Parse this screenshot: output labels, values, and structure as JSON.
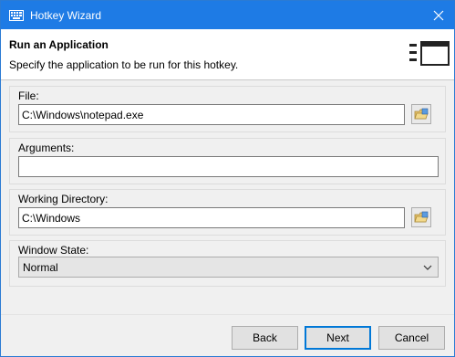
{
  "window": {
    "title": "Hotkey Wizard"
  },
  "header": {
    "title": "Run an Application",
    "subtitle": "Specify the application to be run for this hotkey."
  },
  "fields": {
    "file": {
      "label": "File:",
      "value": "C:\\Windows\\notepad.exe"
    },
    "arguments": {
      "label": "Arguments:",
      "value": ""
    },
    "working_directory": {
      "label": "Working Directory:",
      "value": "C:\\Windows"
    },
    "window_state": {
      "label": "Window State:",
      "selected": "Normal"
    }
  },
  "footer": {
    "back_label": "Back",
    "next_label": "Next",
    "cancel_label": "Cancel"
  },
  "icons": {
    "app": "keyboard-icon",
    "close": "close-icon",
    "wizard": "window-list-icon",
    "browse": "folder-browse-icon",
    "dropdown": "chevron-down-icon"
  },
  "colors": {
    "titlebar": "#1e7be5",
    "accent": "#0078d7"
  }
}
